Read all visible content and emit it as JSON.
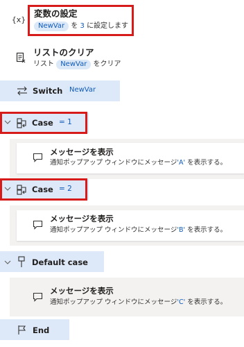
{
  "steps": {
    "set_var": {
      "icon_text": "{x}",
      "title": "変数の設定",
      "var_token": "NewVar",
      "text_before_value": "を",
      "value": "3",
      "text_after_value": "に設定します"
    },
    "clear_list": {
      "title": "リストのクリア",
      "prefix": "リスト",
      "var_token": "NewVar",
      "suffix": "をクリア"
    },
    "switch": {
      "label": "Switch",
      "var_token": "NewVar"
    },
    "case1": {
      "label": "Case",
      "condition": "= 1",
      "message": {
        "title": "メッセージを表示",
        "desc_before": "通知ポップアップ ウィンドウにメッセージ",
        "value": "'A'",
        "desc_after": "を表示する。"
      }
    },
    "case2": {
      "label": "Case",
      "condition": "= 2",
      "message": {
        "title": "メッセージを表示",
        "desc_before": "通知ポップアップ ウィンドウにメッセージ",
        "value": "'B'",
        "desc_after": "を表示する。"
      }
    },
    "default_case": {
      "label": "Default case",
      "message": {
        "title": "メッセージを表示",
        "desc_before": "通知ポップアップ ウィンドウにメッセージ",
        "value": "'C'",
        "desc_after": "を表示する。"
      }
    },
    "end": {
      "label": "End"
    }
  },
  "colors": {
    "highlight_border": "#d71a1a",
    "block_bar": "#dde8f8",
    "token_bg": "#dbe8f8",
    "token_text": "#0f5ab8",
    "panel_bg": "#f3f2f1"
  }
}
